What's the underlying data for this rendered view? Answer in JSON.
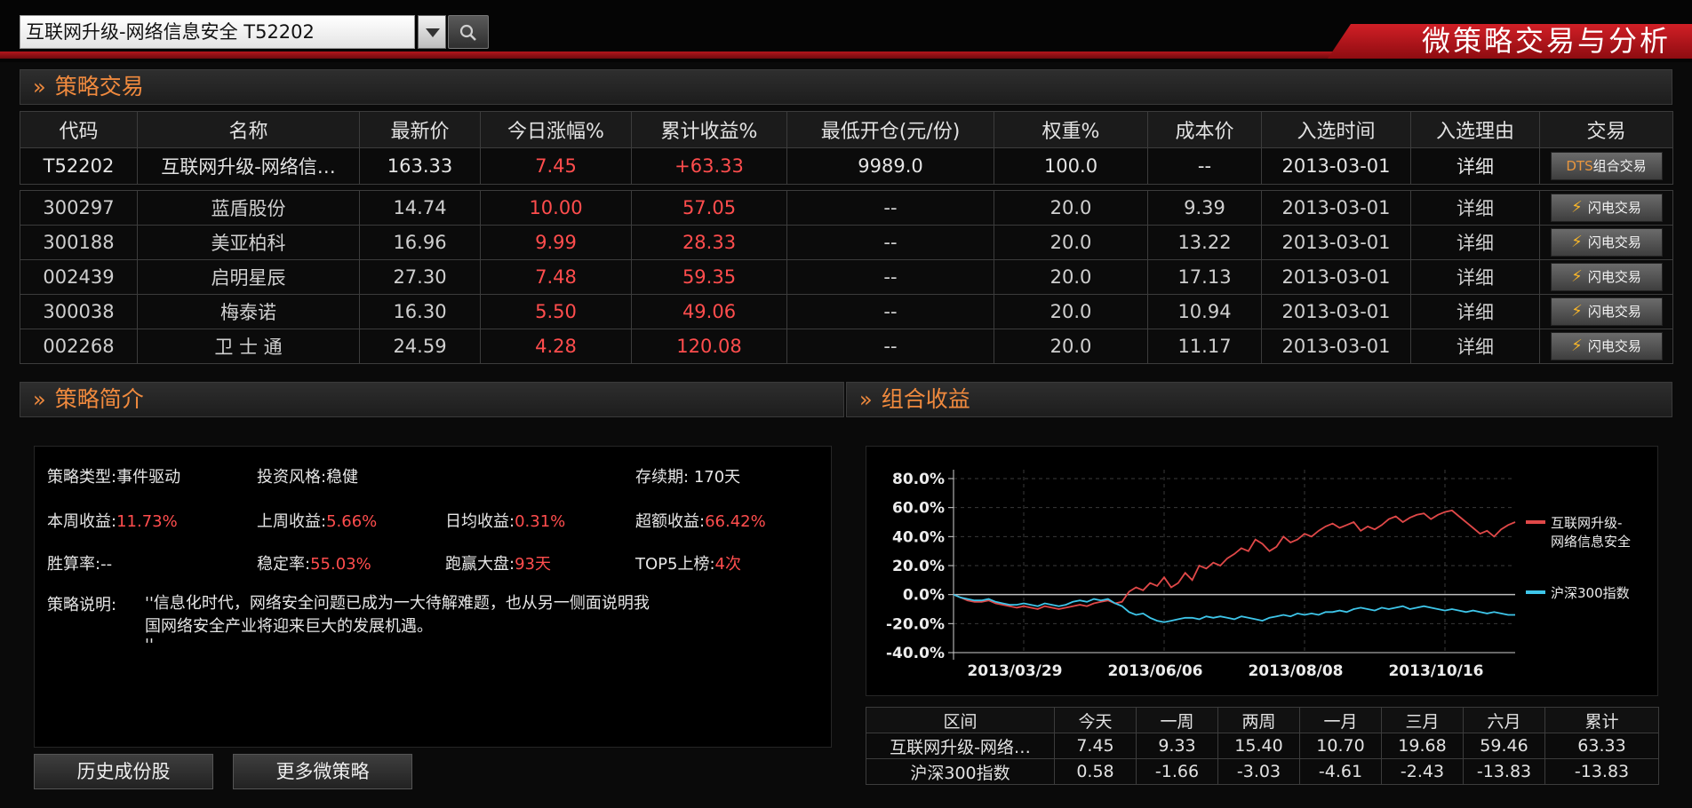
{
  "header": {
    "selector_value": "互联网升级-网络信息安全 T52202",
    "banner_title": "微策略交易与分析"
  },
  "strategy_trade": {
    "title": "策略交易",
    "columns": [
      "代码",
      "名称",
      "最新价",
      "今日涨幅%",
      "累计收益%",
      "最低开仓(元/份)",
      "权重%",
      "成本价",
      "入选时间",
      "入选理由",
      "交易"
    ],
    "main_row": {
      "code": "T52202",
      "name": "互联网升级-网络信…",
      "price": "163.33",
      "today": "7.45",
      "cum": "+63.33",
      "min_open": "9989.0",
      "weight": "100.0",
      "cost": "--",
      "date": "2013-03-01",
      "reason": "详细",
      "btn_prefix": "DTS",
      "btn_suffix": "组合交易"
    },
    "flash_label": "闪电交易",
    "stocks": [
      {
        "code": "300297",
        "name": "蓝盾股份",
        "price": "14.74",
        "today": "10.00",
        "cum": "57.05",
        "min_open": "--",
        "weight": "20.0",
        "cost": "9.39",
        "date": "2013-03-01",
        "reason": "详细"
      },
      {
        "code": "300188",
        "name": "美亚柏科",
        "price": "16.96",
        "today": "9.99",
        "cum": "28.33",
        "min_open": "--",
        "weight": "20.0",
        "cost": "13.22",
        "date": "2013-03-01",
        "reason": "详细"
      },
      {
        "code": "002439",
        "name": "启明星辰",
        "price": "27.30",
        "today": "7.48",
        "cum": "59.35",
        "min_open": "--",
        "weight": "20.0",
        "cost": "17.13",
        "date": "2013-03-01",
        "reason": "详细"
      },
      {
        "code": "300038",
        "name": "梅泰诺",
        "price": "16.30",
        "today": "5.50",
        "cum": "49.06",
        "min_open": "--",
        "weight": "20.0",
        "cost": "10.94",
        "date": "2013-03-01",
        "reason": "详细"
      },
      {
        "code": "002268",
        "name": "卫 士 通",
        "price": "24.59",
        "today": "4.28",
        "cum": "120.08",
        "min_open": "--",
        "weight": "20.0",
        "cost": "11.17",
        "date": "2013-03-01",
        "reason": "详细"
      }
    ]
  },
  "intro": {
    "title": "策略简介",
    "type_label": "策略类型:",
    "type_value": "事件驱动",
    "style_label": "投资风格:",
    "style_value": "稳健",
    "duration_label": "存续期:",
    "duration_value": "170天",
    "week_label": "本周收益:",
    "week_value": "11.73%",
    "lastweek_label": "上周收益:",
    "lastweek_value": "5.66%",
    "daily_label": "日均收益:",
    "daily_value": "0.31%",
    "excess_label": "超额收益:",
    "excess_value": "66.42%",
    "win_label": "胜算率:",
    "win_value": "--",
    "stab_label": "稳定率:",
    "stab_value": "55.03%",
    "beat_label": "跑赢大盘:",
    "beat_value": "93天",
    "top5_label": "TOP5上榜:",
    "top5_value": "4次",
    "desc_label": "策略说明:",
    "desc_line1": "''信息化时代，网络安全问题已成为一大待解难题，也从另一侧面说明我",
    "desc_line2": "国网络安全产业将迎来巨大的发展机遇。",
    "desc_line3": "''",
    "btn_history": "历史成份股",
    "btn_more": "更多微策略"
  },
  "returns": {
    "title": "组合收益",
    "headers": [
      "区间",
      "今天",
      "一周",
      "两周",
      "一月",
      "三月",
      "六月",
      "累计"
    ],
    "rows": [
      [
        "互联网升级-网络…",
        "7.45",
        "9.33",
        "15.40",
        "10.70",
        "19.68",
        "59.46",
        "63.33"
      ],
      [
        "沪深300指数",
        "0.58",
        "-1.66",
        "-3.03",
        "-4.61",
        "-2.43",
        "-13.83",
        "-13.83"
      ]
    ]
  },
  "chart_data": {
    "type": "line",
    "ylim": [
      -40,
      80
    ],
    "yticks": [
      "80.0%",
      "60.0%",
      "40.0%",
      "20.0%",
      "0.0%",
      "-20.0%",
      "-40.0%"
    ],
    "xlabels": [
      "2013/03/29",
      "2013/06/06",
      "2013/08/08",
      "2013/10/16"
    ],
    "xlabel_index": [
      10,
      30,
      50,
      70
    ],
    "grid": true,
    "legend_position": "right",
    "series": [
      {
        "name": "互联网升级-网络信息安全",
        "legend_line1": "互联网升级-",
        "legend_line2": "网络信息安全",
        "color": "#e04848",
        "values": [
          0,
          -2,
          -4,
          -5,
          -5,
          -4,
          -6,
          -7,
          -8,
          -9,
          -8,
          -9,
          -10,
          -8,
          -9,
          -10,
          -9,
          -8,
          -7,
          -8,
          -6,
          -5,
          -4,
          -6,
          -5,
          2,
          5,
          3,
          8,
          6,
          12,
          5,
          8,
          15,
          10,
          20,
          18,
          22,
          20,
          25,
          28,
          32,
          30,
          38,
          35,
          30,
          33,
          40,
          36,
          38,
          42,
          40,
          44,
          47,
          49,
          46,
          48,
          50,
          44,
          47,
          45,
          48,
          52,
          54,
          50,
          53,
          55,
          56,
          52,
          55,
          57,
          58,
          54,
          50,
          46,
          42,
          44,
          40,
          45,
          48,
          50
        ]
      },
      {
        "name": "沪深300指数",
        "color": "#3ec6ea",
        "values": [
          0,
          -2,
          -3,
          -4,
          -4,
          -3,
          -5,
          -6,
          -7,
          -7,
          -6,
          -7,
          -8,
          -6,
          -7,
          -8,
          -7,
          -5,
          -4,
          -5,
          -3,
          -4,
          -3,
          -6,
          -8,
          -12,
          -14,
          -13,
          -16,
          -18,
          -19,
          -18,
          -17,
          -16,
          -16,
          -17,
          -15,
          -16,
          -15,
          -16,
          -17,
          -15,
          -16,
          -17,
          -18,
          -16,
          -15,
          -14,
          -15,
          -13,
          -14,
          -13,
          -14,
          -12,
          -12,
          -11,
          -12,
          -10,
          -9,
          -10,
          -11,
          -9,
          -10,
          -9,
          -8,
          -10,
          -9,
          -8,
          -9,
          -10,
          -11,
          -10,
          -11,
          -12,
          -11,
          -12,
          -13,
          -12,
          -13,
          -14,
          -14
        ]
      }
    ]
  }
}
